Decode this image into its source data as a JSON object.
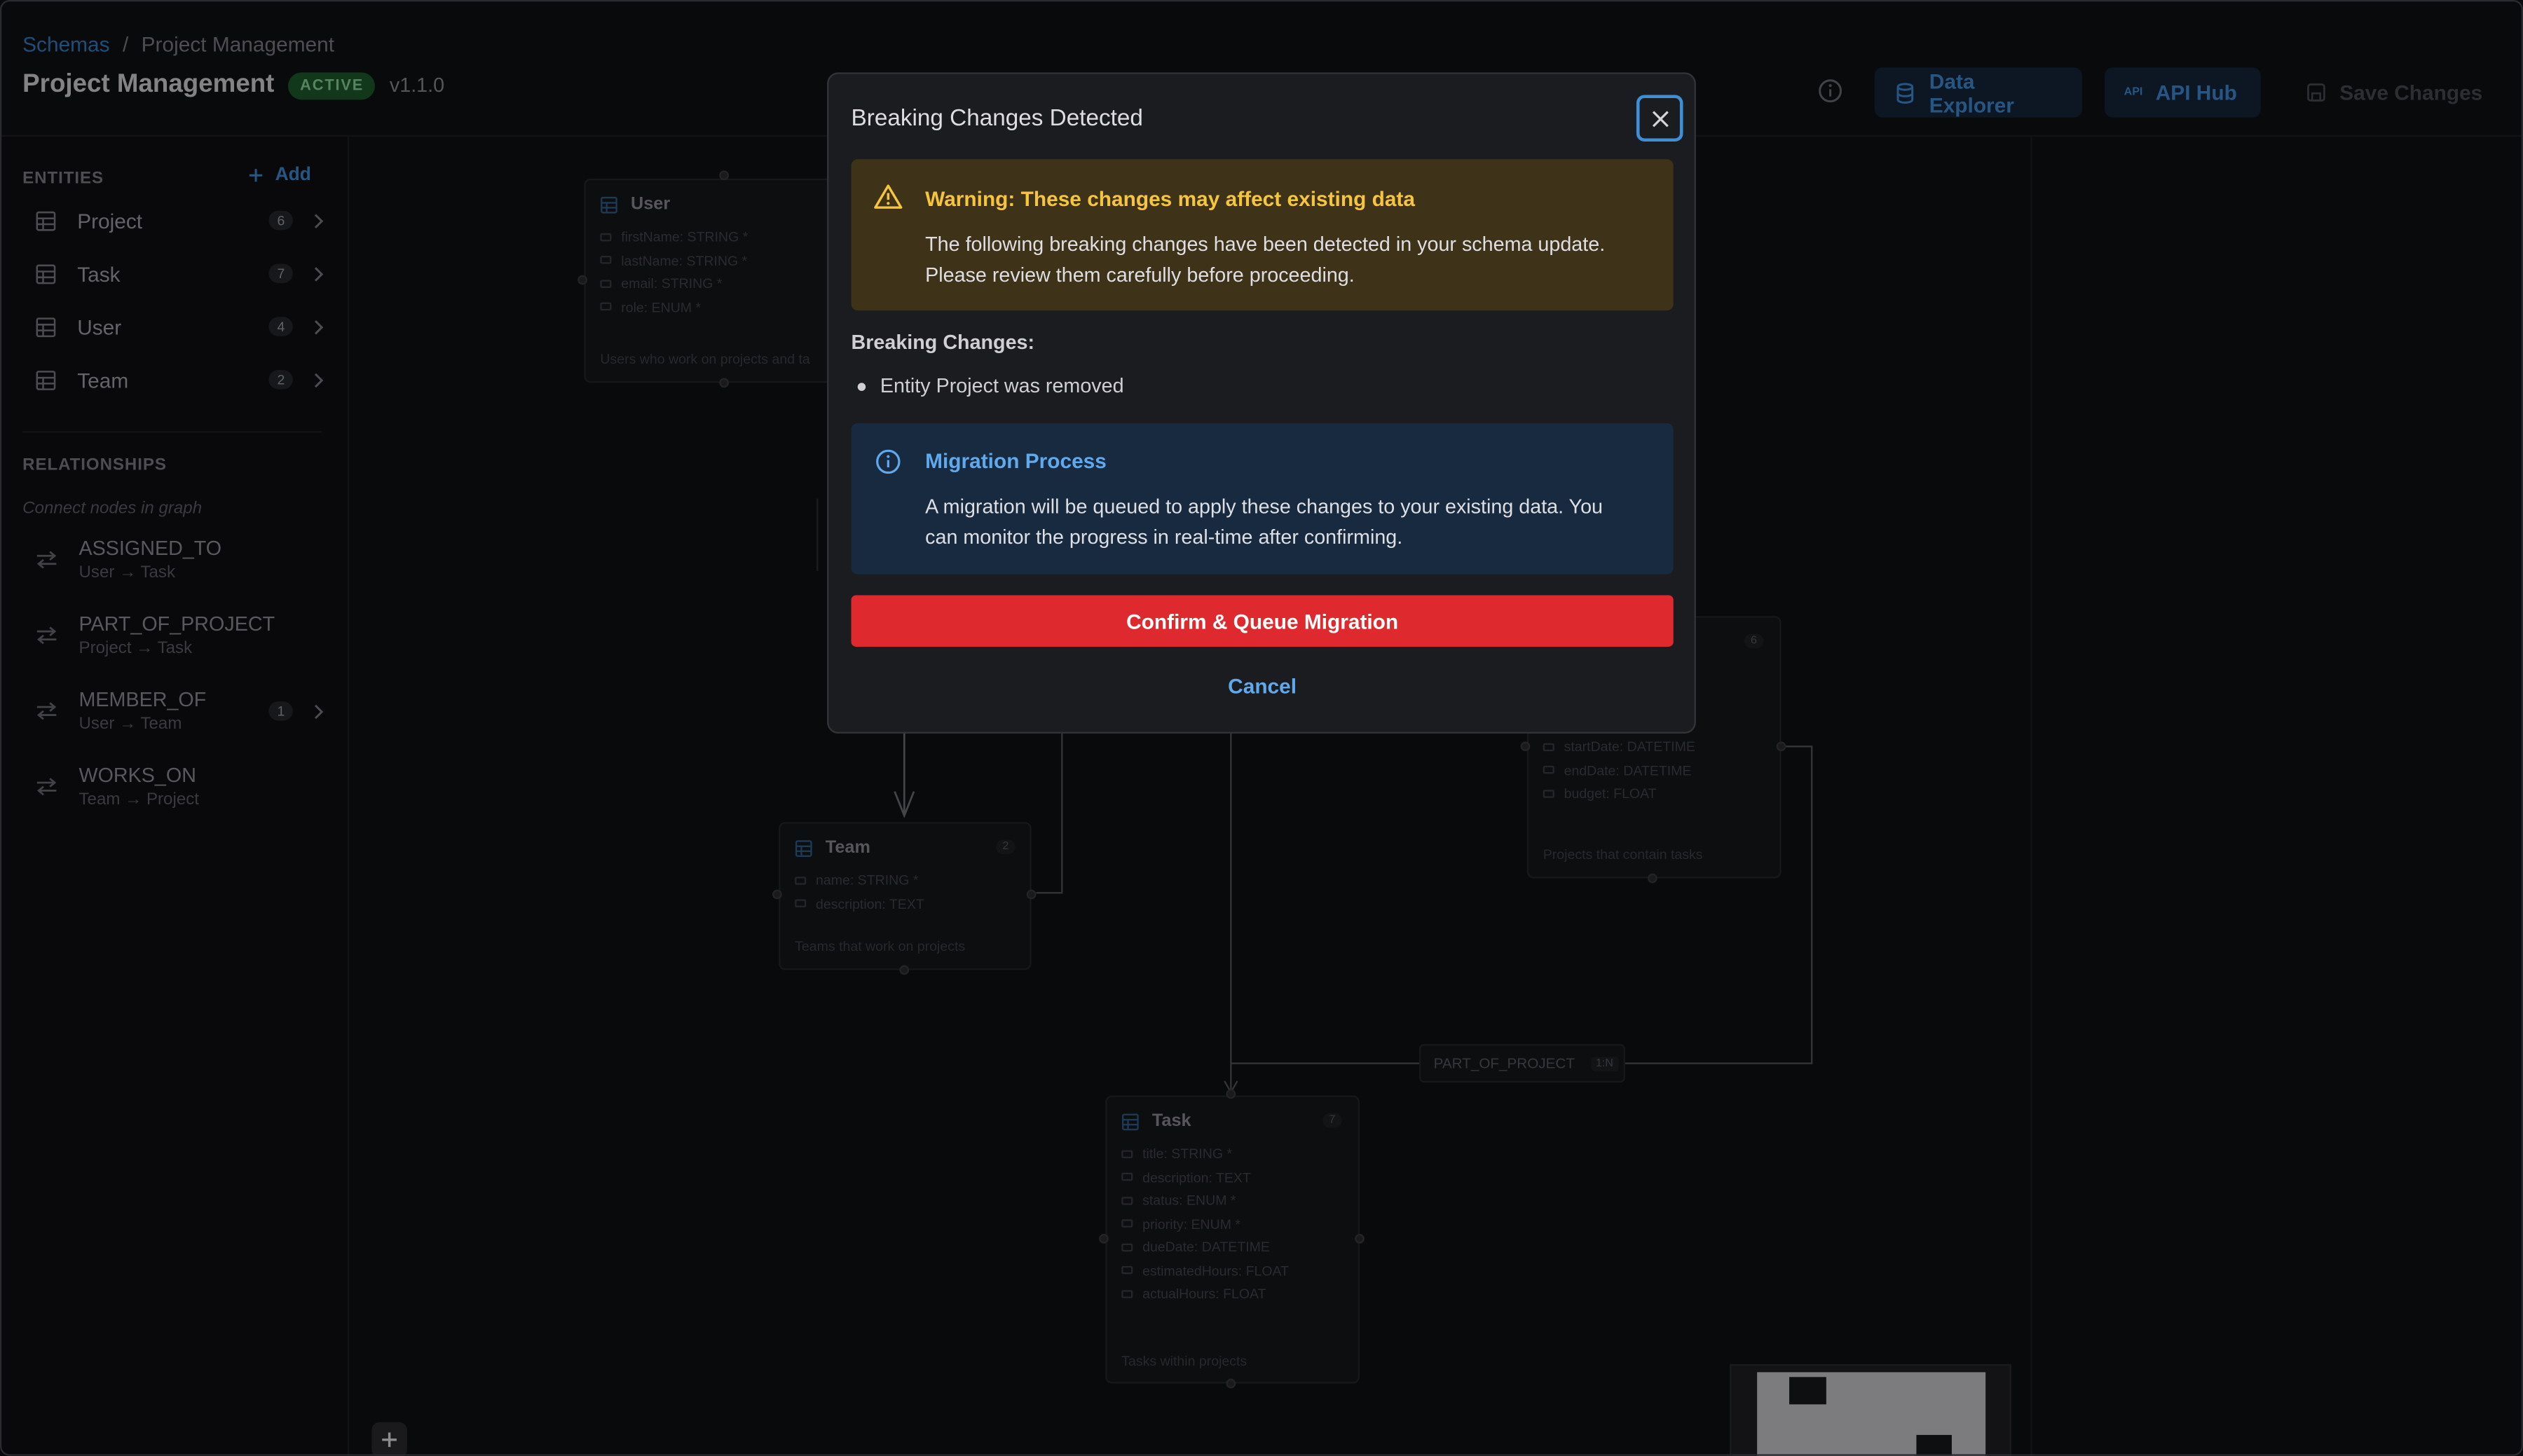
{
  "breadcrumb": {
    "root": "Schemas",
    "separator": "/",
    "current": "Project Management"
  },
  "schema": {
    "title": "Project Management",
    "status": "ACTIVE",
    "version": "v1.1.0"
  },
  "toolbar": {
    "data_explorer": "Data Explorer",
    "api_hub": "API Hub",
    "api_glyph": "API",
    "save_changes": "Save Changes"
  },
  "sidebar": {
    "entities_title": "ENTITIES",
    "add_label": "Add",
    "entities": [
      {
        "label": "Project",
        "count": "6"
      },
      {
        "label": "Task",
        "count": "7"
      },
      {
        "label": "User",
        "count": "4"
      },
      {
        "label": "Team",
        "count": "2"
      }
    ],
    "relationships_title": "RELATIONSHIPS",
    "relationships_hint": "Connect nodes in graph",
    "relationships": [
      {
        "name": "ASSIGNED_TO",
        "path": "User → Task"
      },
      {
        "name": "PART_OF_PROJECT",
        "path": "Project → Task"
      },
      {
        "name": "MEMBER_OF",
        "path": "User → Team",
        "count": "1"
      },
      {
        "name": "WORKS_ON",
        "path": "Team → Project"
      }
    ]
  },
  "graph": {
    "user_node": {
      "title": "User",
      "fields": [
        "firstName: STRING *",
        "lastName: STRING *",
        "email: STRING *",
        "role: ENUM *"
      ],
      "description": "Users who work on projects and ta"
    },
    "team_node": {
      "title": "Team",
      "count": "2",
      "fields": [
        "name: STRING *",
        "description: TEXT"
      ],
      "description": "Teams that work on projects"
    },
    "project_node": {
      "count": "6",
      "fields": [
        "startDate: DATETIME",
        "endDate: DATETIME",
        "budget: FLOAT"
      ],
      "description": "Projects that contain tasks"
    },
    "task_node": {
      "title": "Task",
      "count": "7",
      "fields": [
        "title: STRING *",
        "description: TEXT",
        "status: ENUM *",
        "priority: ENUM *",
        "dueDate: DATETIME",
        "estimatedHours: FLOAT",
        "actualHours: FLOAT"
      ],
      "description": "Tasks within projects"
    },
    "edge_label": {
      "name": "PART_OF_PROJECT",
      "cardinality": "1:N"
    }
  },
  "modal": {
    "title": "Breaking Changes Detected",
    "warning": {
      "heading": "Warning: These changes may affect existing data",
      "line1": "The following breaking changes have been detected in your schema update.",
      "line2": "Please review them carefully before proceeding."
    },
    "breaking_title": "Breaking Changes:",
    "breaking_items": [
      "Entity Project was removed"
    ],
    "migration": {
      "heading": "Migration Process",
      "line1": "A migration will be queued to apply these changes to your existing data. You",
      "line2": "can monitor the progress in real-time after confirming."
    },
    "confirm_label": "Confirm & Queue Migration",
    "cancel_label": "Cancel"
  },
  "colors": {
    "accent": "#3e8bd3",
    "danger": "#de2a2f",
    "warning": "#f5c63c",
    "success": "#8cd39b"
  }
}
